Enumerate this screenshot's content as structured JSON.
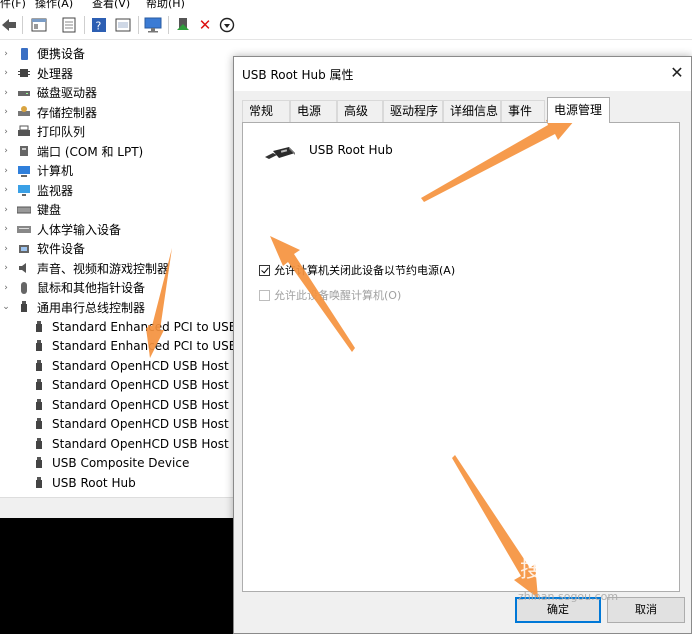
{
  "menubar": {
    "items": [
      "件(F)",
      "操作(A)",
      "查看(V)",
      "帮助(H)"
    ]
  },
  "toolbar": {
    "icons": [
      "back-arrow-icon",
      "properties-icon",
      "update-icon",
      "help-icon",
      "scan-icon",
      "monitor-icon",
      "enable-device-icon",
      "uninstall-icon",
      "download-icon"
    ]
  },
  "tree": {
    "categories": [
      {
        "label": "便携设备",
        "icon": "portable-device-icon"
      },
      {
        "label": "处理器",
        "icon": "processor-icon"
      },
      {
        "label": "磁盘驱动器",
        "icon": "disk-drive-icon"
      },
      {
        "label": "存储控制器",
        "icon": "storage-controller-icon"
      },
      {
        "label": "打印队列",
        "icon": "printer-icon"
      },
      {
        "label": "端口 (COM 和 LPT)",
        "icon": "port-icon"
      },
      {
        "label": "计算机",
        "icon": "computer-icon"
      },
      {
        "label": "监视器",
        "icon": "monitor-icon"
      },
      {
        "label": "键盘",
        "icon": "keyboard-icon"
      },
      {
        "label": "人体学输入设备",
        "icon": "hid-icon"
      },
      {
        "label": "软件设备",
        "icon": "software-device-icon"
      },
      {
        "label": "声音、视频和游戏控制器",
        "icon": "sound-icon"
      },
      {
        "label": "鼠标和其他指针设备",
        "icon": "mouse-icon"
      },
      {
        "label": "通用串行总线控制器",
        "icon": "usb-icon"
      }
    ],
    "usb_children": [
      "Standard Enhanced PCI to USB",
      "Standard Enhanced PCI to USB",
      "Standard OpenHCD USB Host C",
      "Standard OpenHCD USB Host C",
      "Standard OpenHCD USB Host C",
      "Standard OpenHCD USB Host C",
      "Standard OpenHCD USB Host C",
      "USB Composite Device",
      "USB Root Hub"
    ]
  },
  "dialog": {
    "title": "USB Root Hub 属性",
    "close_glyph": "✕",
    "tabs": [
      "常规",
      "电源",
      "高级",
      "驱动程序",
      "详细信息",
      "事件",
      "电源管理"
    ],
    "active_tab": 6,
    "device_name": "USB Root Hub",
    "options": [
      {
        "label": "允许计算机关闭此设备以节约电源(A)",
        "checked": true,
        "enabled": true
      },
      {
        "label": "允许此设备唤醒计算机(O)",
        "checked": false,
        "enabled": false
      }
    ],
    "ok_label": "确定",
    "cancel_label": "取消"
  },
  "watermark": {
    "brand": "搜狗指南",
    "url": "zhinan.sogou.com"
  },
  "colors": {
    "accent": "#0078d7",
    "arrow": "#f5923e"
  }
}
